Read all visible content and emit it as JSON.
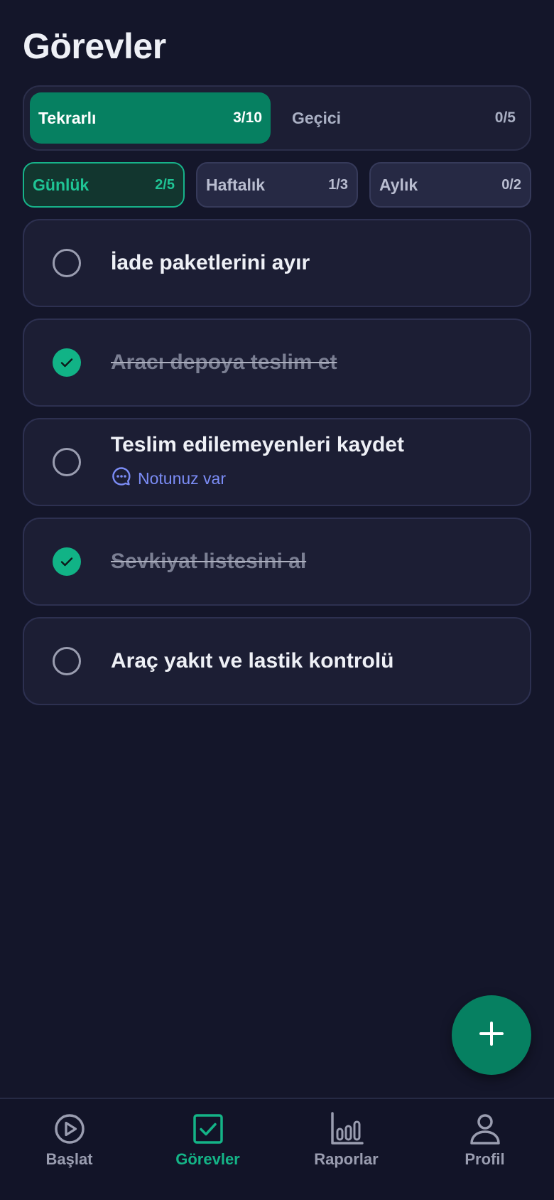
{
  "header": {
    "title": "Görevler"
  },
  "segments": [
    {
      "label": "Tekrarlı",
      "count": "3/10",
      "active": true
    },
    {
      "label": "Geçici",
      "count": "0/5",
      "active": false
    }
  ],
  "periods": [
    {
      "label": "Günlük",
      "count": "2/5",
      "active": true
    },
    {
      "label": "Haftalık",
      "count": "1/3",
      "active": false
    },
    {
      "label": "Aylık",
      "count": "0/2",
      "active": false
    }
  ],
  "tasks": [
    {
      "title": "İade paketlerini ayır",
      "done": false
    },
    {
      "title": "Aracı depoya teslim et",
      "done": true
    },
    {
      "title": "Teslim edilemeyenleri kaydet",
      "done": false,
      "note": "Notunuz var"
    },
    {
      "title": "Sevkiyat listesini al",
      "done": true
    },
    {
      "title": "Araç yakıt ve lastik kontrolü",
      "done": false
    }
  ],
  "fab": {
    "icon": "plus-icon"
  },
  "nav": [
    {
      "label": "Başlat",
      "icon": "play-circle-icon",
      "active": false
    },
    {
      "label": "Görevler",
      "icon": "checkbox-icon",
      "active": true
    },
    {
      "label": "Raporlar",
      "icon": "bar-chart-icon",
      "active": false
    },
    {
      "label": "Profil",
      "icon": "user-icon",
      "active": false
    }
  ],
  "colors": {
    "background": "#14162a",
    "accent": "#068061",
    "accent_text": "#14b487",
    "note": "#7b8cf5"
  }
}
